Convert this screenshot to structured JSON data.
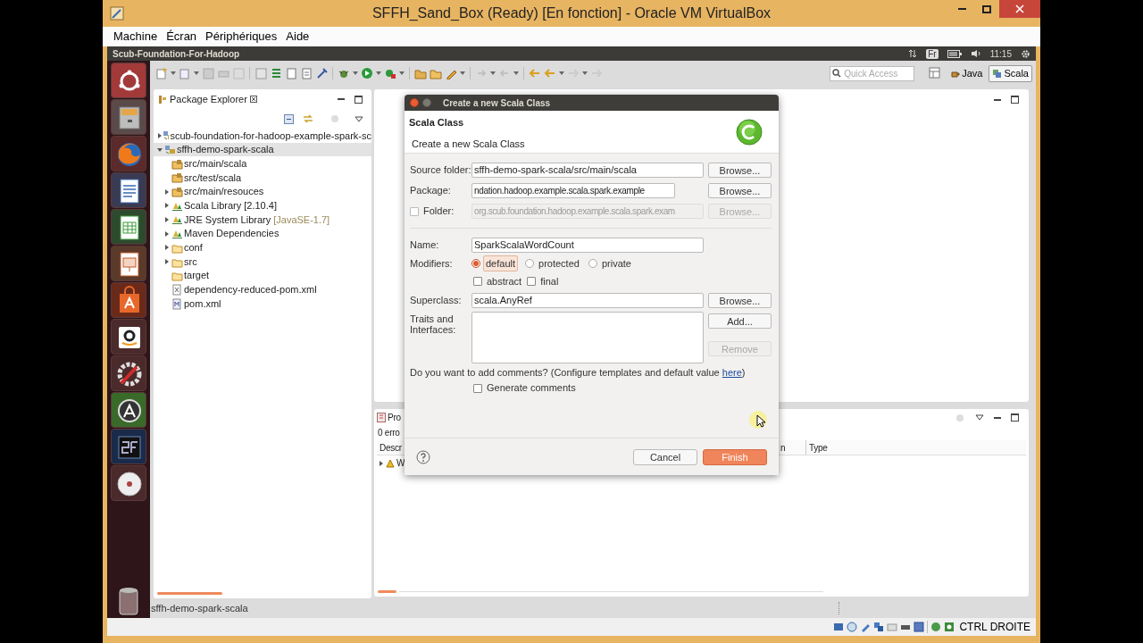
{
  "window": {
    "title": "SFFH_Sand_Box (Ready) [En fonction] - Oracle VM VirtualBox"
  },
  "menu": [
    "Machine",
    "Écran",
    "Périphériques",
    "Aide"
  ],
  "top_panel": {
    "title": "Scub-Foundation-For-Hadoop",
    "keyboard_layout": "Fr",
    "time": "11:15"
  },
  "toolbar": {
    "quick_access_placeholder": "Quick Access",
    "perspectives": [
      {
        "label": "Java",
        "selected": false
      },
      {
        "label": "Scala",
        "selected": true
      }
    ]
  },
  "package_explorer": {
    "title": "Package Explorer",
    "tree": [
      {
        "label": "scub-foundation-for-hadoop-example-spark-sc",
        "kind": "project",
        "expanded": false,
        "selected": false
      },
      {
        "label": "sffh-demo-spark-scala",
        "kind": "project",
        "expanded": true,
        "selected": true,
        "children": [
          {
            "label": "src/main/scala",
            "kind": "source",
            "selected": false
          },
          {
            "label": "src/test/scala",
            "kind": "source",
            "selected": false
          },
          {
            "label": "src/main/resouces",
            "kind": "source",
            "expanded": false,
            "selected": false
          },
          {
            "label": "Scala Library [2.10.4]",
            "kind": "library",
            "expanded": false,
            "selected": false
          },
          {
            "label": "JRE System Library",
            "decoration": "[JavaSE-1.7]",
            "kind": "library",
            "expanded": false,
            "selected": false
          },
          {
            "label": "Maven Dependencies",
            "kind": "library",
            "expanded": false,
            "selected": false
          },
          {
            "label": "conf",
            "kind": "folder",
            "expanded": false,
            "selected": false
          },
          {
            "label": "src",
            "kind": "folder",
            "expanded": false,
            "selected": false
          },
          {
            "label": "target",
            "kind": "folder",
            "selected": false
          },
          {
            "label": "dependency-reduced-pom.xml",
            "kind": "xml",
            "selected": false
          },
          {
            "label": "pom.xml",
            "kind": "maven",
            "selected": false
          }
        ]
      }
    ]
  },
  "problems": {
    "tab": "Pro",
    "summary": "0 erro",
    "columns": [
      "Descr",
      "n",
      "Type"
    ],
    "rows": [
      {
        "label": "W",
        "expanded": false
      }
    ]
  },
  "dialog": {
    "title": "Create a new Scala Class",
    "heading": "Scala Class",
    "description": "Create a new Scala Class",
    "source_folder": {
      "label": "Source folder:",
      "value": "sffh-demo-spark-scala/src/main/scala",
      "button": "Browse..."
    },
    "package": {
      "label": "Package:",
      "value": "ndation.hadoop.example.scala.spark.example",
      "button": "Browse..."
    },
    "folder": {
      "label": "Folder:",
      "checked": false,
      "disabled": true,
      "value": "org.scub.foundation.hadoop.example.scala.spark.exam",
      "button": "Browse..."
    },
    "name": {
      "label": "Name:",
      "value": "SparkScalaWordCount"
    },
    "modifiers": {
      "label": "Modifiers:",
      "options": [
        {
          "label": "default",
          "selected": true
        },
        {
          "label": "protected",
          "selected": false
        },
        {
          "label": "private",
          "selected": false
        }
      ],
      "flags": [
        {
          "label": "abstract",
          "checked": false
        },
        {
          "label": "final",
          "checked": false
        }
      ]
    },
    "superclass": {
      "label": "Superclass:",
      "value": "scala.AnyRef",
      "button": "Browse..."
    },
    "traits": {
      "label": "Traits and Interfaces:",
      "buttons": [
        {
          "label": "Add...",
          "disabled": false
        },
        {
          "label": "Remove",
          "disabled": true
        }
      ]
    },
    "comments": {
      "text": "Do you want to add comments? (Configure templates and default value ",
      "link": "here",
      "text_end": ")"
    },
    "generate_comments": {
      "label": "Generate comments",
      "checked": false
    },
    "buttons": [
      {
        "label": "Cancel",
        "default": false
      },
      {
        "label": "Finish",
        "default": true
      }
    ]
  },
  "status_line": "sffh-demo-spark-scala",
  "vbox_status": {
    "host_key": "CTRL DROITE"
  }
}
